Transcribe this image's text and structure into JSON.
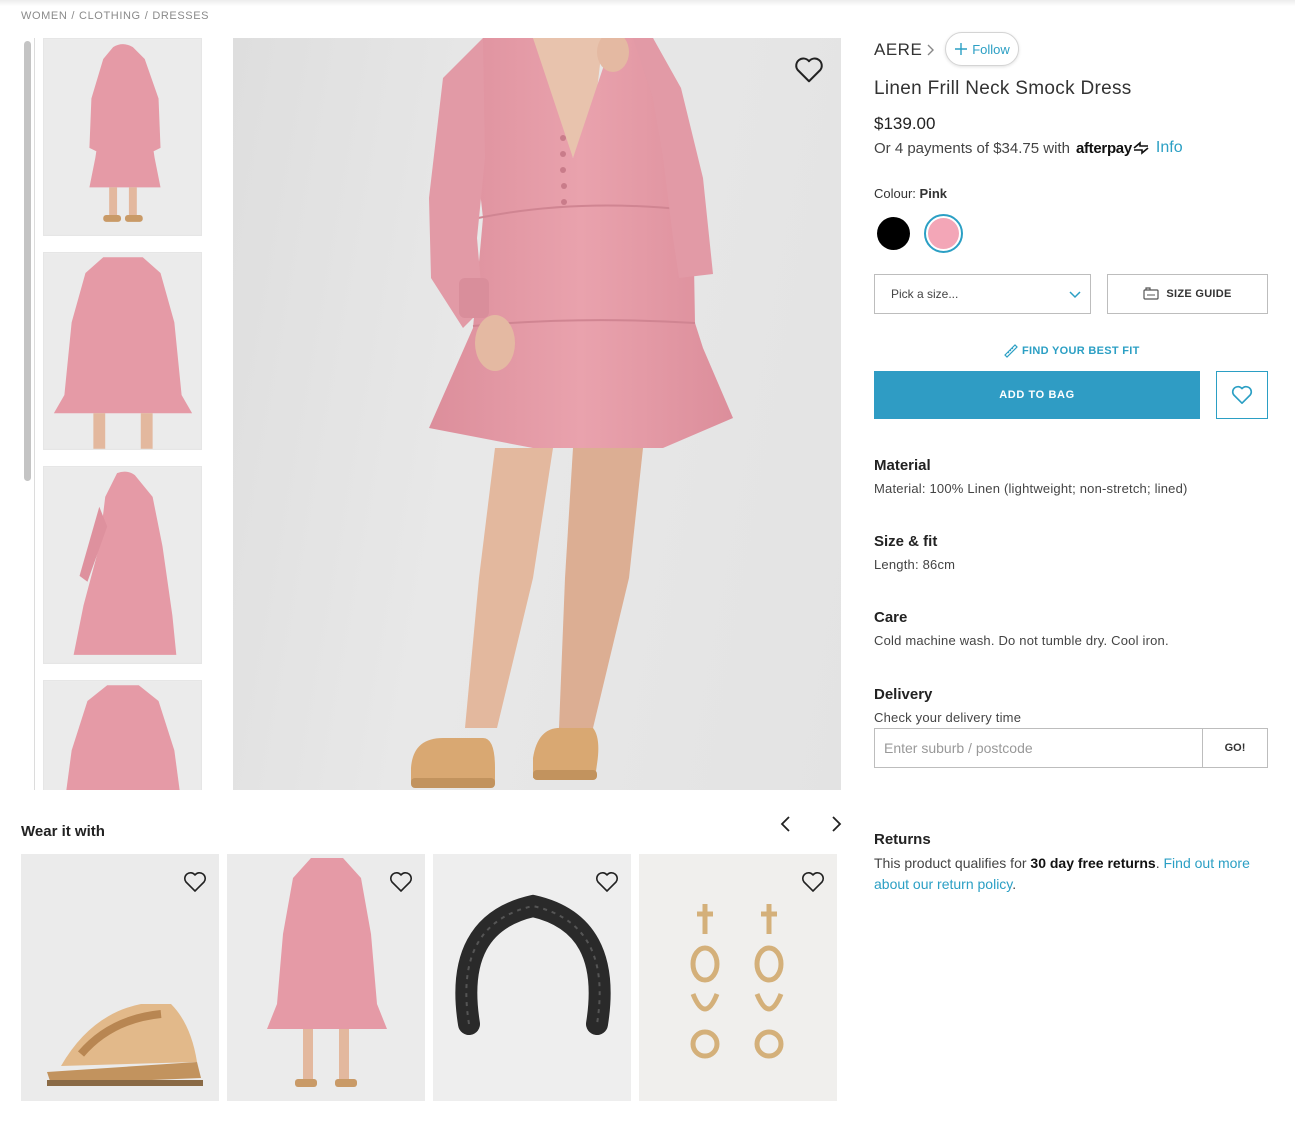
{
  "breadcrumb": [
    "WOMEN",
    "CLOTHING",
    "DRESSES"
  ],
  "breadcrumb_sep": "/",
  "product": {
    "brand": "AERE",
    "follow_label": "Follow",
    "title": "Linen Frill Neck Smock Dress",
    "price": "$139.00",
    "afterpay_text": "Or 4 payments of $34.75 with",
    "afterpay_logo": "afterpay",
    "afterpay_info": "Info",
    "colour_label": "Colour:",
    "colour_value": "Pink",
    "colours": [
      {
        "name": "Black",
        "hex": "#000000",
        "selected": false
      },
      {
        "name": "Pink",
        "hex": "#f3a6b7",
        "selected": true
      }
    ],
    "size_placeholder": "Pick a size...",
    "size_guide_label": "SIZE GUIDE",
    "best_fit_label": "FIND YOUR BEST FIT",
    "add_to_bag_label": "ADD TO BAG"
  },
  "details": {
    "material_head": "Material",
    "material_body": "Material: 100% Linen (lightweight; non-stretch; lined)",
    "size_head": "Size & fit",
    "size_body": "Length: 86cm",
    "care_head": "Care",
    "care_body": "Cold machine wash. Do not tumble dry. Cool iron.",
    "delivery_head": "Delivery",
    "delivery_body": "Check your delivery time",
    "delivery_placeholder": "Enter suburb / postcode",
    "delivery_go": "GO!",
    "returns_head": "Returns",
    "returns_pre": "This product qualifies for",
    "returns_bold": "30 day free returns",
    "returns_mid": ".",
    "returns_link": "Find out more about our return policy",
    "returns_end": "."
  },
  "wear_it_with": {
    "title": "Wear it with",
    "items": [
      {
        "kind": "sandal"
      },
      {
        "kind": "dress"
      },
      {
        "kind": "headband"
      },
      {
        "kind": "earrings"
      }
    ]
  },
  "colors": {
    "accent": "#2b9fc4",
    "button": "#2f9cc4",
    "dress": "#e59aa6"
  }
}
